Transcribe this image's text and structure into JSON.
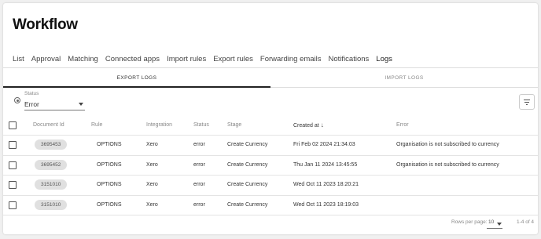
{
  "page": {
    "title": "Workflow"
  },
  "tabs": [
    {
      "label": "List"
    },
    {
      "label": "Approval"
    },
    {
      "label": "Matching"
    },
    {
      "label": "Connected apps"
    },
    {
      "label": "Import rules"
    },
    {
      "label": "Export rules"
    },
    {
      "label": "Forwarding emails"
    },
    {
      "label": "Notifications"
    },
    {
      "label": "Logs",
      "active": true
    }
  ],
  "subtabs": [
    {
      "label": "EXPORT LOGS",
      "active": true
    },
    {
      "label": "IMPORT LOGS",
      "active": false
    }
  ],
  "filter": {
    "label": "Status",
    "value": "Error"
  },
  "table": {
    "headers": {
      "document_id": "Document Id",
      "rule": "Rule",
      "integration": "Integration",
      "status": "Status",
      "stage": "Stage",
      "created_at": "Created at",
      "created_at_sort": "↓",
      "error": "Error"
    },
    "rows": [
      {
        "document_id": "3695453",
        "rule": "OPTIONS",
        "integration": "Xero",
        "status": "error",
        "stage": "Create Currency",
        "created_at": "Fri Feb 02 2024 21:34:03",
        "error": "Organisation is not subscribed to currency"
      },
      {
        "document_id": "3695452",
        "rule": "OPTIONS",
        "integration": "Xero",
        "status": "error",
        "stage": "Create Currency",
        "created_at": "Thu Jan 11 2024 13:45:55",
        "error": "Organisation is not subscribed to currency"
      },
      {
        "document_id": "3151010",
        "rule": "OPTIONS",
        "integration": "Xero",
        "status": "error",
        "stage": "Create Currency",
        "created_at": "Wed Oct 11 2023 18:20:21",
        "error": ""
      },
      {
        "document_id": "3151010",
        "rule": "OPTIONS",
        "integration": "Xero",
        "status": "error",
        "stage": "Create Currency",
        "created_at": "Wed Oct 11 2023 18:19:03",
        "error": ""
      }
    ]
  },
  "pagination": {
    "rows_per_page_label": "Rows per page:",
    "rows_per_page": "10",
    "range": "1-4 of 4"
  },
  "colors": {
    "accent": "#1a6ed8"
  }
}
